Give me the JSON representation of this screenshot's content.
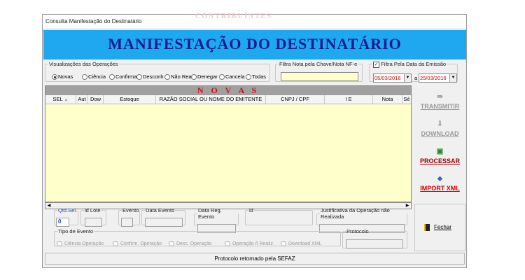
{
  "window": {
    "title": "Consulta Manifestação do Destinatário",
    "watermark": "CONTRIBUÍNTES",
    "banner": "MANIFESTAÇÃO DO DESTINATÁRIO"
  },
  "visualizacoes": {
    "legend": "Visualizações das Operações",
    "options": [
      "Novas",
      "Ciência",
      "Confirma",
      "Desconh",
      "Não Rea",
      "Denegar",
      "Cancela",
      "Todas"
    ],
    "selected": "Novas"
  },
  "filtro_chave": {
    "legend": "Filtra Nota pela Chave/Nota NF-e",
    "value": ""
  },
  "filtro_data": {
    "label": "Filtra Pela Data da Emissão",
    "checked": true,
    "date_from": "05/03/2016",
    "sep": "a",
    "date_to": "25/03/2016"
  },
  "grid": {
    "caption": "N O V A S",
    "columns": [
      "SEL",
      "Aut",
      "Dow",
      "Estoque",
      "RAZÃO SOCIAL OU NOME DO EMITENTE",
      "CNPJ / CPF",
      "I E",
      "Nota",
      "Sé"
    ]
  },
  "actions": {
    "transmitir": "TRANSMITIR",
    "download": "DOWNLOAD",
    "processar": "PROCESSAR",
    "import_xml": "IMPORT XML",
    "fechar": "Fechar"
  },
  "info": {
    "qtd_sel": {
      "legend": "Qtd.Sel.",
      "value": "0"
    },
    "id_lote": {
      "legend": "id Lote"
    },
    "evento": {
      "legend": "Evento"
    },
    "data_evento": {
      "legend": "Data Evento"
    },
    "data_reg_evento": {
      "legend": "Data Reg. Evento"
    },
    "id": {
      "legend": "id"
    },
    "justificativa": {
      "legend": "Justificativa da Operação não Realizada"
    }
  },
  "tipo_evento": {
    "legend": "Tipo de Evento",
    "options": [
      "Ciência Operação",
      "Confirm. Operação",
      "Desc. Operação",
      "Operação ñ Realiz.",
      "Download XML"
    ]
  },
  "protocolo": {
    "legend": "Protocolo"
  },
  "status": "Protocolo retornado pela SEFAZ"
}
